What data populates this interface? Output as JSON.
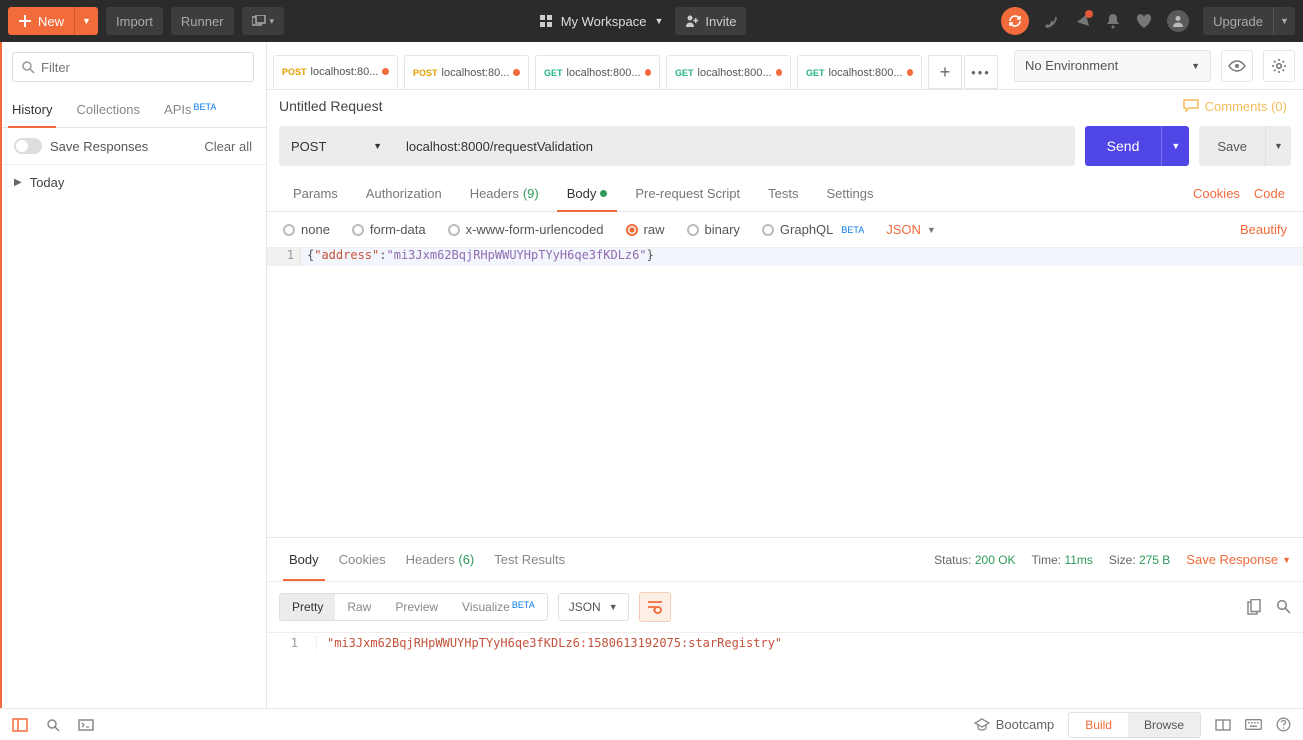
{
  "topbar": {
    "new": "New",
    "import": "Import",
    "runner": "Runner",
    "workspace": "My Workspace",
    "invite": "Invite",
    "upgrade": "Upgrade"
  },
  "sidebar": {
    "filter_placeholder": "Filter",
    "tabs": {
      "history": "History",
      "collections": "Collections",
      "apis": "APIs",
      "beta": "BETA"
    },
    "save_responses": "Save Responses",
    "clear_all": "Clear all",
    "today": "Today"
  },
  "tabs": [
    {
      "verb": "POST",
      "label": "localhost:80..."
    },
    {
      "verb": "POST",
      "label": "localhost:80..."
    },
    {
      "verb": "GET",
      "label": "localhost:800..."
    },
    {
      "verb": "GET",
      "label": "localhost:800..."
    },
    {
      "verb": "GET",
      "label": "localhost:800..."
    }
  ],
  "env": {
    "selected": "No Environment"
  },
  "request": {
    "title": "Untitled Request",
    "comments": "Comments (0)",
    "method": "POST",
    "url": "localhost:8000/requestValidation",
    "send": "Send",
    "save": "Save",
    "tabs": {
      "params": "Params",
      "authorization": "Authorization",
      "headers": "Headers",
      "headers_count": "(9)",
      "body": "Body",
      "prerequest": "Pre-request Script",
      "tests": "Tests",
      "settings": "Settings",
      "cookies": "Cookies",
      "code": "Code"
    },
    "body_types": {
      "none": "none",
      "formdata": "form-data",
      "urlencoded": "x-www-form-urlencoded",
      "raw": "raw",
      "binary": "binary",
      "graphql": "GraphQL",
      "graphql_beta": "BETA",
      "content_sel": "JSON",
      "beautify": "Beautify"
    },
    "body_code": {
      "line": "1",
      "key": "\"address\"",
      "val": "\"mi3Jxm62BqjRHpWWUYHpTYyH6qe3fKDLz6\""
    }
  },
  "response": {
    "tabs": {
      "body": "Body",
      "cookies": "Cookies",
      "headers": "Headers",
      "headers_count": "(6)",
      "tests": "Test Results"
    },
    "status_label": "Status:",
    "status_val": "200 OK",
    "time_label": "Time:",
    "time_val": "11ms",
    "size_label": "Size:",
    "size_val": "275 B",
    "save_response": "Save Response",
    "toolbar": {
      "pretty": "Pretty",
      "raw": "Raw",
      "preview": "Preview",
      "visualize": "Visualize",
      "viz_beta": "BETA",
      "json": "JSON"
    },
    "body_line": "1",
    "body_text": "\"mi3Jxm62BqjRHpWWUYHpTYyH6qe3fKDLz6:1580613192075:starRegistry\""
  },
  "footer": {
    "bootcamp": "Bootcamp",
    "build": "Build",
    "browse": "Browse"
  }
}
